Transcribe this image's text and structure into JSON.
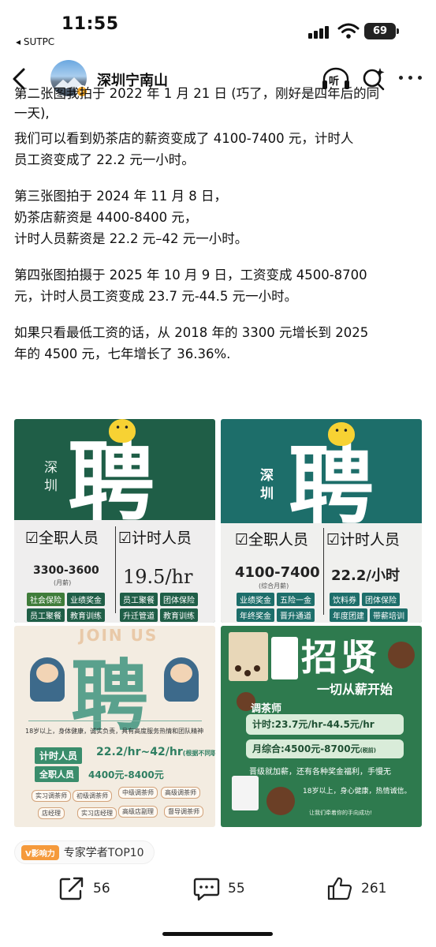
{
  "status_bar": {
    "time": "11:55",
    "carrier_back": "◂ SUTPC",
    "battery": "69"
  },
  "nav": {
    "title": "深圳宁南山",
    "listen_label": "听"
  },
  "article": {
    "partial_line": "第二张图我拍于 2022 年 1 月 21 日 (巧了，刚好是四年后的同",
    "lines": [
      "一天),",
      "我们可以看到奶茶店的薪资变成了 4100-7400 元，计时人",
      "员工资变成了 22.2 元一小时。",
      "",
      "第三张图拍于 2024 年 11 月 8 日，",
      "奶茶店薪资是 4400-8400 元，",
      "计时人员薪资是 22.2 元–42 元一小时。",
      "",
      "第四张图拍摄于 2025 年 10 月 9 日，工资变成 4500-8700",
      "元，计时人员工资变成 23.7 元-44.5 元一小时。",
      "",
      "如果只看最低工资的话，从 2018 年的 3300 元增长到 2025",
      "年的 4500 元，七年增长了 36.36%."
    ]
  },
  "images": {
    "poster1": {
      "city": "深圳",
      "hire": "聘",
      "fulltime": "全职人员",
      "parttime": "计时人员",
      "fulltime_pay": "3300-3600",
      "fulltime_note": "(月薪)",
      "parttime_pay": "19.5/hr",
      "chips": [
        "社会保险",
        "业绩奖金",
        "员工聚餐",
        "团体保险",
        "员工聚餐",
        "教育训练",
        "升迁管道",
        "教育训练"
      ]
    },
    "poster2": {
      "city": "深圳",
      "hire": "聘",
      "fulltime": "全职人员",
      "parttime": "计时人员",
      "fulltime_pay": "4100-7400",
      "fulltime_note": "(综合月薪)",
      "parttime_pay": "22.2/小时",
      "chips": [
        "业绩奖金",
        "五险一金",
        "饮料券",
        "团体保险",
        "年终奖金",
        "晋升通道",
        "年度团建",
        "带薪培训"
      ]
    },
    "poster3": {
      "join_us": "JOIN US",
      "hire": "聘",
      "intro": "18岁以上，身体健康，诚实负责，具有高度服务热情和团队精神",
      "parttime_label": "计时人员",
      "parttime_pay": "22.2/hr~42/hr",
      "parttime_note": "(根据不同职级)",
      "fulltime_label": "全职人员",
      "fulltime_pay": "4400元-8400元",
      "roles": [
        "实习调茶师",
        "初级调茶师",
        "中级调茶师",
        "高级调茶师",
        "店经理",
        "实习店经理",
        "高级店副理",
        "督导调茶师"
      ]
    },
    "poster4": {
      "title": "招贤",
      "slogan": "一切从薪开始",
      "role": "调茶师",
      "hourly": "计时:23.7元/hr-44.5元/hr",
      "monthly": "月综合:4500元-8700元",
      "monthly_note": "(税前)",
      "benefits": "晋级就加薪，还有各种奖金福利，手慢无",
      "requirement": "18岁以上，身心健康，热情诚信。",
      "footer": "让我们牵着你的手向成功!"
    }
  },
  "badge": {
    "logo": "V影响力",
    "text": "专家学者TOP10"
  },
  "actions": {
    "share_count": "56",
    "comment_count": "55",
    "like_count": "261"
  }
}
